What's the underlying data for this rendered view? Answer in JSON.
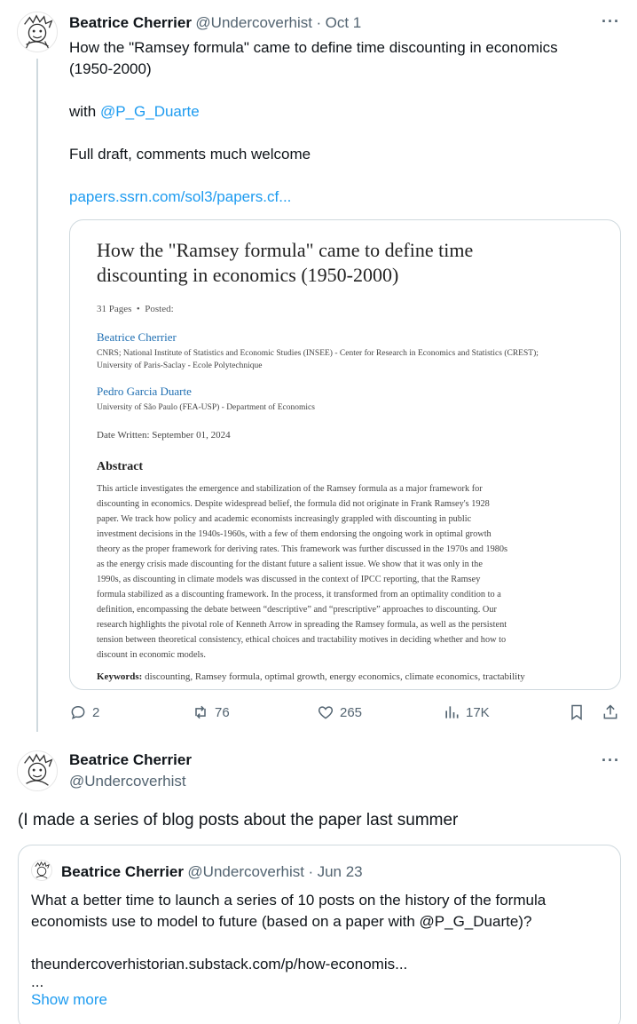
{
  "tweet1": {
    "display_name": "Beatrice Cherrier",
    "handle": "@Undercoverhist",
    "separator": "·",
    "date": "Oct 1",
    "line1": "How the \"Ramsey formula\" came to define time discounting in economics",
    "line2": "(1950-2000)",
    "with_prefix": "with ",
    "mention": "@P_G_Duarte",
    "line4": "Full draft, comments much welcome",
    "link": "papers.ssrn.com/sol3/papers.cf...",
    "more_icon": "more-dots-icon",
    "card": {
      "title_line1": "How the \"Ramsey formula\" came to define time",
      "title_line2": "discounting in economics (1950-2000)",
      "pages": "31 Pages",
      "bullet": "•",
      "posted": "Posted:",
      "author1": "Beatrice Cherrier",
      "affil1_line1": "CNRS; National Institute of Statistics and Economic Studies (INSEE) - Center for Research in Economics and Statistics (CREST);",
      "affil1_line2": "University of Paris-Saclay - Ecole Polytechnique",
      "author2": "Pedro Garcia Duarte",
      "affil2": "University of São Paulo (FEA-USP) - Department of Economics",
      "date_written": "Date Written: September 01, 2024",
      "abstract_heading": "Abstract",
      "abstract_lines": [
        "This article investigates the emergence and stabilization of the Ramsey formula as a major framework for",
        "discounting in economics. Despite widespread belief, the formula did not originate in Frank Ramsey's 1928",
        "paper. We track how policy and academic economists increasingly grappled with discounting in public",
        "investment decisions in the 1940s-1960s, with a few of them endorsing the ongoing work in optimal growth",
        "theory as the proper framework for deriving rates. This framework was further discussed in the 1970s and 1980s",
        "as the energy crisis made discounting for the distant future a salient issue. We show that it was only in the",
        "1990s, as discounting in climate models was discussed in the context of IPCC reporting, that the Ramsey",
        "formula stabilized as a discounting framework. In the process, it transformed from an optimality condition to a",
        "definition, encompassing the debate between “descriptive” and “prescriptive” approaches to discounting. Our",
        "research highlights the pivotal role of Kenneth Arrow in spreading the Ramsey formula, as well as the persistent",
        "tension between theoretical consistency, ethical choices and tractability motives in deciding whether and how to",
        "discount in economic models."
      ],
      "keywords_label": "Keywords:",
      "keywords": "discounting, Ramsey formula, optimal growth, energy economics, climate economics, tractability"
    },
    "actions": {
      "replies": "2",
      "retweets": "76",
      "likes": "265",
      "views": "17K"
    }
  },
  "tweet2": {
    "display_name": "Beatrice Cherrier",
    "handle": "@Undercoverhist",
    "text": "(I made a series of blog posts about the paper last summer",
    "quote": {
      "display_name": "Beatrice Cherrier",
      "handle": "@Undercoverhist",
      "separator": "·",
      "date": "Jun 23",
      "line1": "What a better time to launch a series of 10 posts on the history of the formula",
      "line2": "economists use to model to future (based on a paper with @P_G_Duarte)?",
      "link": "theundercoverhistorian.substack.com/p/how-economis...",
      "ellipsis": "...",
      "show_more": "Show more"
    }
  },
  "colors": {
    "link": "#1d9bf0",
    "muted": "#536471",
    "border": "#cfd9de"
  }
}
